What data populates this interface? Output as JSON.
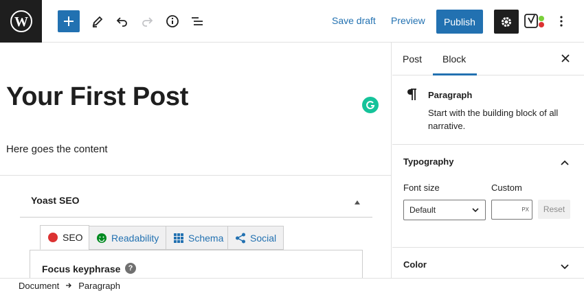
{
  "toolbar": {
    "save_draft": "Save draft",
    "preview": "Preview",
    "publish": "Publish"
  },
  "editor": {
    "post_title": "Your First Post",
    "content": "Here goes the content"
  },
  "yoast": {
    "title": "Yoast SEO",
    "tabs": [
      {
        "label": "SEO",
        "status_color": "#dc3232"
      },
      {
        "label": "Readability",
        "status_color": "#008a20"
      },
      {
        "label": "Schema"
      },
      {
        "label": "Social"
      }
    ],
    "focus_keyphrase_label": "Focus keyphrase",
    "help_glyph": "?"
  },
  "sidebar": {
    "tabs": [
      {
        "label": "Post"
      },
      {
        "label": "Block",
        "active": true
      }
    ],
    "block": {
      "name": "Paragraph",
      "description": "Start with the building block of all narrative."
    },
    "typography": {
      "title": "Typography",
      "font_size_label": "Font size",
      "font_size_value": "Default",
      "custom_label": "Custom",
      "unit": "PX",
      "reset_label": "Reset"
    },
    "color": {
      "title": "Color"
    }
  },
  "footer": {
    "breadcrumb": [
      "Document",
      "Paragraph"
    ]
  },
  "colors": {
    "accent": "#2271b1",
    "dark": "#1e1e1e",
    "grammarly": "#15c39a"
  }
}
